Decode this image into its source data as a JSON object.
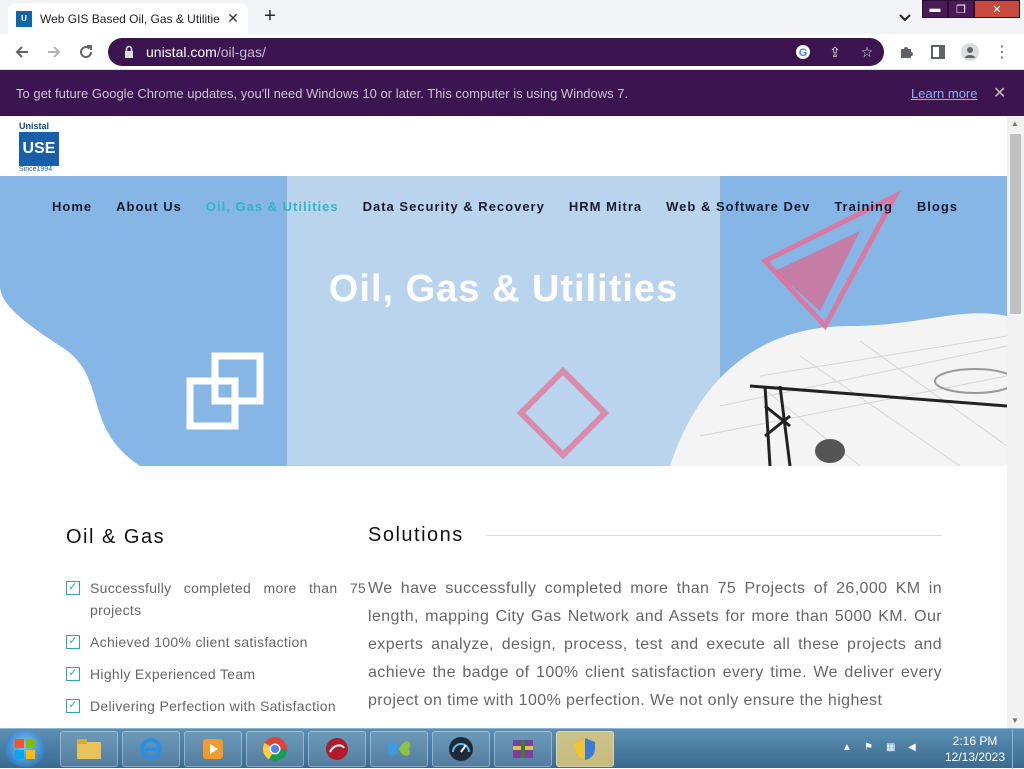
{
  "browser": {
    "tab_title": "Web GIS Based Oil, Gas & Utilitie",
    "url_host": "unistal.com",
    "url_path": "/oil-gas/",
    "infobar_message": "To get future Google Chrome updates, you'll need Windows 10 or later. This computer is using Windows 7.",
    "infobar_link": "Learn more"
  },
  "logo": {
    "top": "Unistal",
    "mark": "USE",
    "since": "Since1994"
  },
  "nav": {
    "items": [
      "Home",
      "About Us",
      "Oil, Gas & Utilities",
      "Data Security & Recovery",
      "HRM Mitra",
      "Web & Software Dev",
      "Training",
      "Blogs"
    ],
    "active": "Oil, Gas & Utilities"
  },
  "hero": {
    "title": "Oil, Gas & Utilities"
  },
  "oil_gas": {
    "heading": "Oil & Gas",
    "features": [
      "Successfully completed more than 75 projects",
      "Achieved 100% client satisfaction",
      "Highly Experienced Team",
      "Delivering Perfection with Satisfaction"
    ]
  },
  "solutions": {
    "heading": "Solutions",
    "text": "We have successfully completed more than 75 Projects of 26,000 KM in length, mapping City Gas Network and Assets for more than 5000 KM. Our experts analyze, design, process, test and execute all these projects and achieve the badge of 100% client satisfaction every time. We deliver every project on time with 100% perfection. We not only ensure the highest"
  },
  "taskbar": {
    "time": "2:16 PM",
    "date": "12/13/2023"
  },
  "colors": {
    "accent": "#2fb5c9",
    "chrome_dark": "#3c1450",
    "hero_blue": "#88b8e6"
  }
}
